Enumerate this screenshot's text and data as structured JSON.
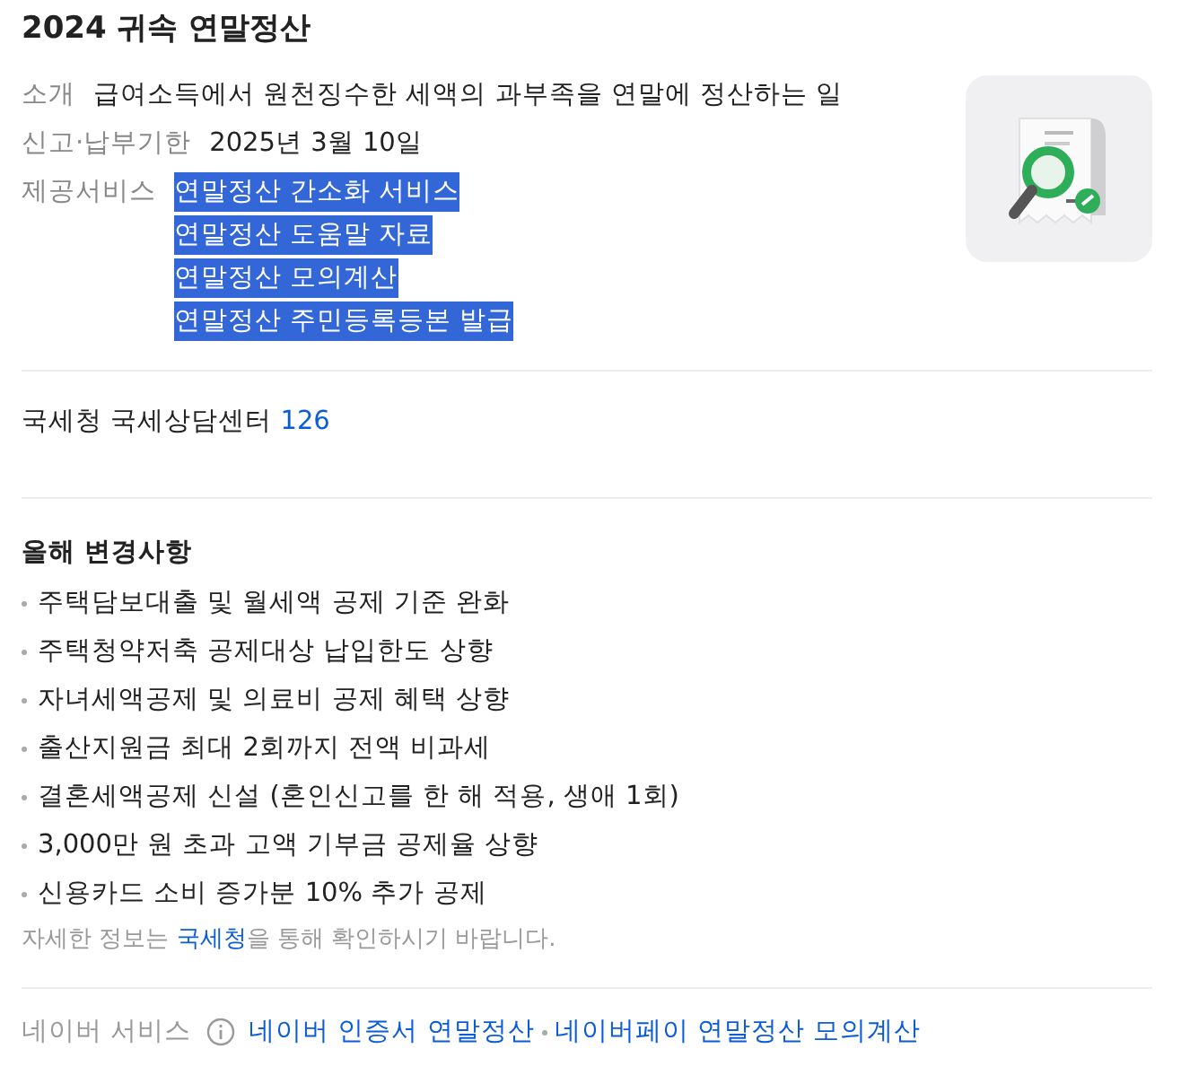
{
  "title": "2024 귀속 연말정산",
  "info": [
    {
      "kind": "text",
      "label": "소개",
      "value": "급여소득에서 원천징수한 세액의 과부족을 연말에 정산하는 일"
    },
    {
      "kind": "text",
      "label": "신고·납부기한",
      "value": "2025년 3월 10일"
    },
    {
      "kind": "links",
      "label": "제공서비스",
      "links": [
        {
          "text": "연말정산 간소화 서비스",
          "selected": true
        },
        {
          "text": "연말정산 도움말 자료",
          "selected": true
        },
        {
          "text": "연말정산 모의계산",
          "selected": true
        },
        {
          "text": "연말정산 주민등록등본 발급",
          "selected": true
        }
      ]
    }
  ],
  "contact": {
    "text": "국세청 국세상담센터",
    "number": "126"
  },
  "changes": {
    "heading": "올해 변경사항",
    "items": [
      "주택담보대출 및 월세액 공제 기준 완화",
      "주택청약저축 공제대상 납입한도 상향",
      "자녀세액공제 및 의료비 공제 혜택 상향",
      "출산지원금 최대 2회까지 전액 비과세",
      "결혼세액공제 신설 (혼인신고를 한 해 적용, 생애 1회)",
      "3,000만 원 초과 고액 기부금 공제율 상향",
      "신용카드 소비 증가분 10% 추가 공제"
    ],
    "note": {
      "before": "자세한 정보는 ",
      "link": "국세청",
      "after": "을 통해 확인하시기 바랍니다."
    }
  },
  "footer": {
    "label": "네이버 서비스",
    "links": [
      "네이버 인증서 연말정산",
      "네이버페이 연말정산 모의계산"
    ]
  }
}
